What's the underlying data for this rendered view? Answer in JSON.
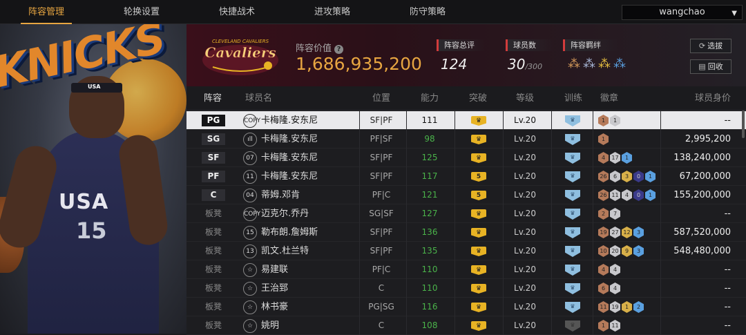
{
  "nav": {
    "tabs": [
      {
        "label": "阵容管理",
        "active": true
      },
      {
        "label": "轮换设置",
        "active": false
      },
      {
        "label": "快捷战术",
        "active": false
      },
      {
        "label": "进攻策略",
        "active": false
      },
      {
        "label": "防守策略",
        "active": false
      }
    ],
    "username": "wangchao"
  },
  "poster": {
    "team_text": "KNICKS",
    "headband": "USA",
    "jersey_text": "USA",
    "jersey_number": "15"
  },
  "header": {
    "team_logo": "CLEVELAND CAVALIERS",
    "value_label": "阵容价值",
    "value": "1,686,935,200",
    "rating_label": "阵容总评",
    "rating": "124",
    "count_label": "球员数",
    "count": "30",
    "count_max": "/300",
    "chem_label": "阵容羁绊",
    "scout_button": "选拔",
    "recycle_button": "回收"
  },
  "table": {
    "headers": {
      "lineup": "阵容",
      "name": "球员名",
      "position": "位置",
      "ability": "能力",
      "breakthrough": "突破",
      "level": "等级",
      "training": "训练",
      "badges": "徽章",
      "value": "球员身价"
    },
    "rows": [
      {
        "slot": "PG",
        "icon": "COPY",
        "name": "卡梅隆.安东尼",
        "pos": "SF|PF",
        "ability": "111",
        "brk": "♛",
        "level": "Lv.20",
        "price": "--",
        "badges": [
          [
            "b-br",
            "1"
          ],
          [
            "b-si",
            "1"
          ]
        ]
      },
      {
        "slot": "SG",
        "icon": "ıll",
        "name": "卡梅隆.安东尼",
        "pos": "PF|SF",
        "ability": "98",
        "brk": "♛",
        "level": "Lv.20",
        "price": "2,995,200",
        "badges": [
          [
            "b-br",
            "1"
          ]
        ]
      },
      {
        "slot": "SF",
        "icon": "07",
        "name": "卡梅隆.安东尼",
        "pos": "SF|PF",
        "ability": "125",
        "brk": "♛",
        "level": "Lv.20",
        "price": "138,240,000",
        "badges": [
          [
            "b-br",
            "4"
          ],
          [
            "b-si",
            "17"
          ],
          [
            "b-bl",
            "1"
          ]
        ]
      },
      {
        "slot": "PF",
        "icon": "11",
        "name": "卡梅隆.安东尼",
        "pos": "SF|PF",
        "ability": "117",
        "brk": "5",
        "level": "Lv.20",
        "price": "67,200,000",
        "badges": [
          [
            "b-br",
            "26"
          ],
          [
            "b-si",
            "6"
          ],
          [
            "b-go",
            "3"
          ],
          [
            "b-pu",
            "0"
          ],
          [
            "b-bl",
            "1"
          ]
        ]
      },
      {
        "slot": "C",
        "icon": "04",
        "name": "蒂姆.邓肯",
        "pos": "PF|C",
        "ability": "121",
        "brk": "5",
        "level": "Lv.20",
        "price": "155,200,000",
        "badges": [
          [
            "b-br",
            "26"
          ],
          [
            "b-si",
            "11"
          ],
          [
            "b-si",
            "4"
          ],
          [
            "b-pu",
            "0"
          ],
          [
            "b-bl",
            "1"
          ]
        ]
      },
      {
        "slot": "板凳",
        "icon": "COPY",
        "name": "迈克尔.乔丹",
        "pos": "SG|SF",
        "ability": "127",
        "brk": "♛",
        "level": "Lv.20",
        "price": "--",
        "badges": [
          [
            "b-br",
            "2"
          ],
          [
            "b-si",
            "7"
          ]
        ]
      },
      {
        "slot": "板凳",
        "icon": "15",
        "name": "勒布朗.詹姆斯",
        "pos": "SF|PF",
        "ability": "136",
        "brk": "♛",
        "level": "Lv.20",
        "price": "587,520,000",
        "badges": [
          [
            "b-br",
            "19"
          ],
          [
            "b-si",
            "27"
          ],
          [
            "b-go",
            "12"
          ],
          [
            "b-bl",
            "3"
          ]
        ]
      },
      {
        "slot": "板凳",
        "icon": "13",
        "name": "凯文.杜兰特",
        "pos": "SF|PF",
        "ability": "135",
        "brk": "♛",
        "level": "Lv.20",
        "price": "548,480,000",
        "badges": [
          [
            "b-br",
            "10"
          ],
          [
            "b-si",
            "20"
          ],
          [
            "b-go",
            "9"
          ],
          [
            "b-bl",
            "3"
          ]
        ]
      },
      {
        "slot": "板凳",
        "icon": "☆",
        "name": "易建联",
        "pos": "PF|C",
        "ability": "110",
        "brk": "♛",
        "level": "Lv.20",
        "price": "--",
        "badges": [
          [
            "b-br",
            "4"
          ],
          [
            "b-si",
            "4"
          ]
        ]
      },
      {
        "slot": "板凳",
        "icon": "☆",
        "name": "王治郅",
        "pos": "C",
        "ability": "110",
        "brk": "♛",
        "level": "Lv.20",
        "price": "--",
        "badges": [
          [
            "b-br",
            "6"
          ],
          [
            "b-si",
            "4"
          ]
        ]
      },
      {
        "slot": "板凳",
        "icon": "☆",
        "name": "林书豪",
        "pos": "PG|SG",
        "ability": "116",
        "brk": "♛",
        "level": "Lv.20",
        "price": "--",
        "badges": [
          [
            "b-br",
            "11"
          ],
          [
            "b-si",
            "19"
          ],
          [
            "b-go",
            "1"
          ],
          [
            "b-bl",
            "2"
          ]
        ]
      },
      {
        "slot": "板凳",
        "icon": "☆",
        "name": "姚明",
        "pos": "C",
        "ability": "108",
        "brk": "♛",
        "level": "Lv.20",
        "price": "--",
        "badges": [
          [
            "b-br",
            "1"
          ],
          [
            "b-si",
            "11"
          ]
        ]
      }
    ]
  }
}
